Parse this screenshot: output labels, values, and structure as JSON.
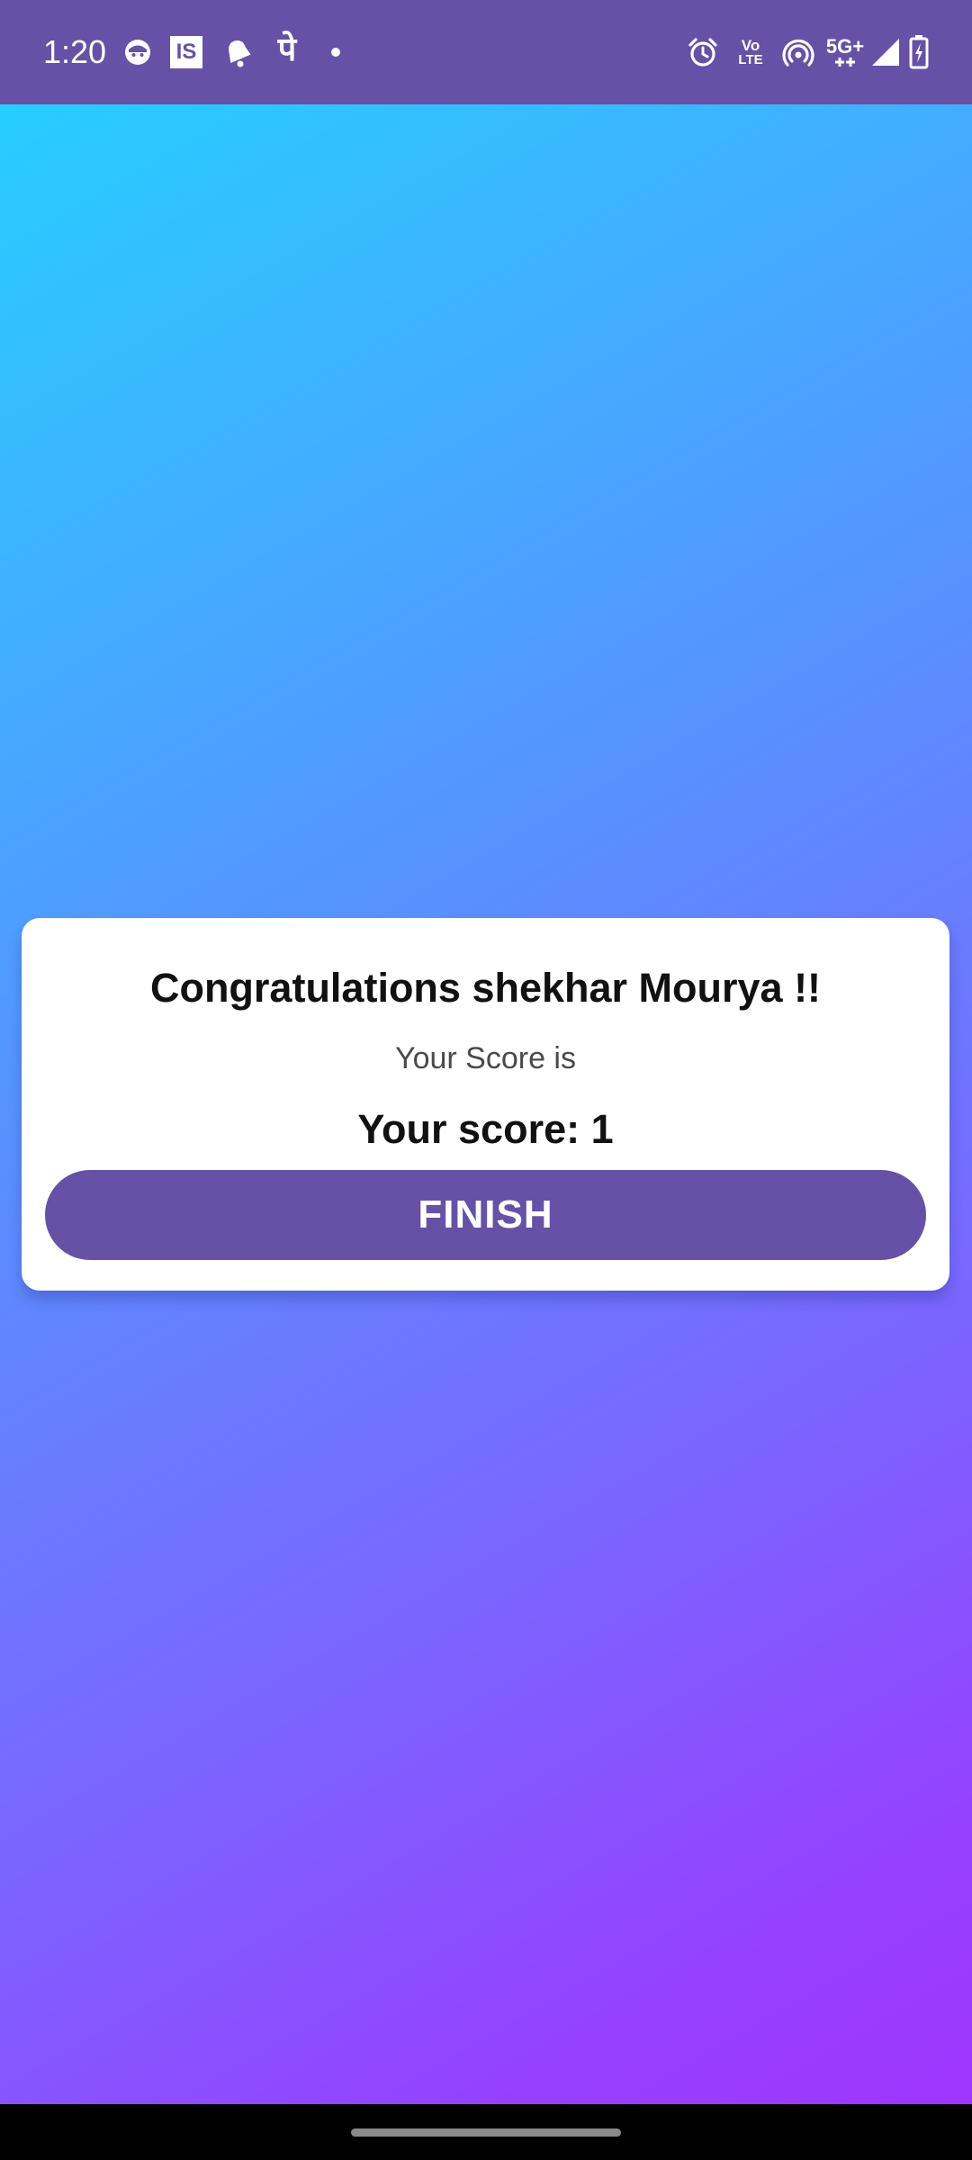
{
  "status_bar": {
    "time": "1:20",
    "icons_left": [
      "face-app-icon",
      "is-app-icon",
      "notification-bell-icon",
      "phonepe-icon",
      "dot-icon"
    ],
    "is_label": "IS",
    "phonepe_label": "पे",
    "volte_top": "Vo",
    "volte_bottom": "LTE",
    "network_label": "5G+",
    "icons_right": [
      "alarm-icon",
      "volte-icon",
      "hotspot-icon",
      "5g-icon",
      "signal-icon",
      "battery-charging-icon"
    ],
    "background_color": "#6651a6"
  },
  "background": {
    "gradient_colors": [
      "#22d4ff",
      "#5c8cff",
      "#a033ff"
    ]
  },
  "dialog": {
    "title": "Congratulations shekhar Mourya  !!",
    "subtitle": "Your Score is",
    "score_text": "Your score: 1",
    "finish_label": "FINISH",
    "button_color": "#6651a6"
  }
}
